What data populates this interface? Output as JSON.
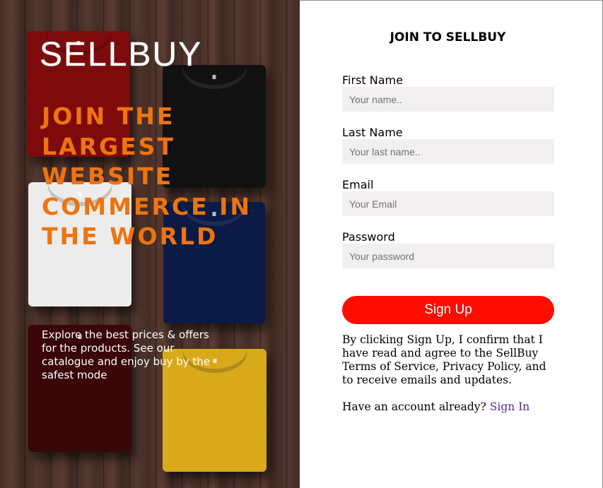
{
  "hero": {
    "logo_text": "SELLBUY",
    "headline": "JOIN THE LARGEST WEBSITE COMMERCE IN THE WORLD",
    "tagline": "Explore the best prices & offers for the products. See our catalogue and enjoy buy by the safest mode",
    "shirts": [
      "red",
      "black",
      "white",
      "navy",
      "maroon",
      "yellow"
    ]
  },
  "form": {
    "title": "JOIN TO SELLBUY",
    "fields": [
      {
        "label": "First Name",
        "placeholder": "Your name..",
        "value": ""
      },
      {
        "label": "Last Name",
        "placeholder": "Your last name..",
        "value": ""
      },
      {
        "label": "Email",
        "placeholder": "Your Email",
        "value": ""
      },
      {
        "label": "Password",
        "placeholder": "Your password",
        "value": ""
      }
    ],
    "submit_label": "Sign Up",
    "terms_text": "By clicking Sign Up, I confirm that I have read and agree to the SellBuy Terms of Service, Privacy Policy, and to receive emails and updates.",
    "have_account_text": "Have an account already?",
    "signin_label": "Sign In"
  },
  "colors": {
    "accent_orange": "#ee7410",
    "signup_red": "#ff0d00",
    "input_bg": "#f1efef",
    "link_purple": "#5b2a8e"
  }
}
